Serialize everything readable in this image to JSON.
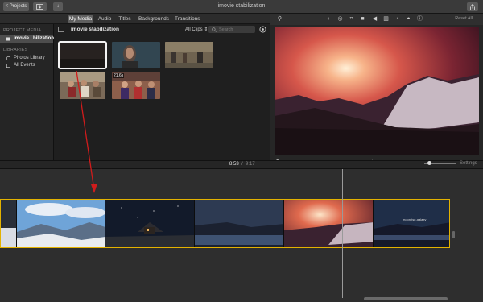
{
  "titlebar": {
    "projects_button": "< Projects",
    "window_title": "imovie stabilization",
    "import_icon": "download-arrow-icon",
    "view_icon": "grid-icon",
    "share_icon": "share-icon"
  },
  "tabs": [
    {
      "label": "My Media",
      "active": true
    },
    {
      "label": "Audio",
      "active": false
    },
    {
      "label": "Titles",
      "active": false
    },
    {
      "label": "Backgrounds",
      "active": false
    },
    {
      "label": "Transitions",
      "active": false
    }
  ],
  "sidebar": {
    "project_media_heading": "PROJECT MEDIA",
    "project_item": "imovie...bilization",
    "libraries_heading": "LIBRARIES",
    "library_items": [
      "Photos Library",
      "All Events"
    ]
  },
  "browser": {
    "title": "imovie stabilization",
    "filter": "All Clips",
    "search_placeholder": "Search",
    "clip_badge": "21.6s"
  },
  "viewer": {
    "reset_label": "Reset All",
    "tools": [
      "magic-wand-icon",
      "color-balance-icon",
      "color-correction-icon",
      "crop-icon",
      "stabilization-icon",
      "volume-icon",
      "equalizer-icon",
      "speed-icon",
      "noise-reduction-icon",
      "info-icon"
    ]
  },
  "timecode": {
    "current": "8:53",
    "separator": "/",
    "total": "9:17"
  },
  "timeline": {
    "settings_label": "Settings",
    "clip_text": "moonrise-galaxy"
  },
  "colors": {
    "selection_border": "#e3b200",
    "audio_track": "#2a56b8",
    "arrow": "#d01c1c"
  }
}
